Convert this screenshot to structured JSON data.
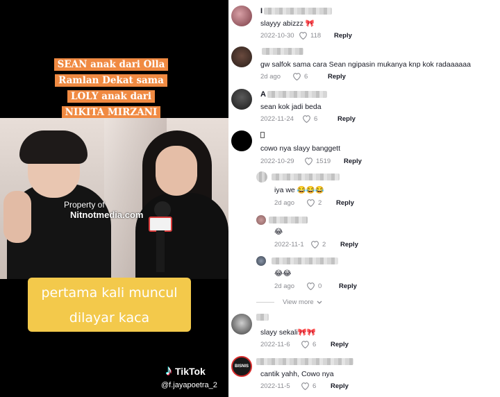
{
  "video": {
    "overlay_title_lines": [
      "SEAN anak dari Olla",
      "Ramlan Dekat sama",
      "LOLY anak dari",
      "NIKITA MIRZANI"
    ],
    "watermark": {
      "line1": "Property of",
      "line2": "Nitnotmedia.com"
    },
    "caption_lines": [
      "pertama kali muncul",
      "dilayar kaca"
    ],
    "platform": "TikTok",
    "handle": "@f.jayapoetra_2"
  },
  "comments": [
    {
      "username_prefix": "I",
      "text": "slayyy abizzz 🎀",
      "date": "2022-10-30",
      "likes": "118",
      "reply_label": "Reply"
    },
    {
      "username_prefix": "",
      "text": "gw salfok sama cara Sean ngipasin mukanya knp kok radaaaaaa",
      "date": "2d ago",
      "likes": "6",
      "reply_label": "Reply"
    },
    {
      "username_prefix": "A",
      "text": "sean kok jadi beda",
      "date": "2022-11-24",
      "likes": "6",
      "reply_label": "Reply"
    },
    {
      "username_prefix": "",
      "text": "cowo nya slayy banggett",
      "date": "2022-10-29",
      "likes": "1519",
      "reply_label": "Reply"
    },
    {
      "username_prefix": "",
      "text": "iya we 😂😂😂",
      "date": "2d ago",
      "likes": "2",
      "reply_label": "Reply"
    },
    {
      "username_prefix": "",
      "text": "😂",
      "date": "2022-11-1",
      "likes": "2",
      "reply_label": "Reply"
    },
    {
      "username_prefix": "",
      "text": "😂😂",
      "date": "2d ago",
      "likes": "0",
      "reply_label": "Reply"
    },
    {
      "username_prefix": "",
      "text": "slayy sekali🎀🎀",
      "date": "2022-11-6",
      "likes": "6",
      "reply_label": "Reply"
    },
    {
      "username_prefix": "",
      "text": "cantik yahh, Cowo nya",
      "date": "2022-11-5",
      "likes": "6",
      "reply_label": "Reply"
    }
  ],
  "view_more_label": "View more",
  "avatar_badge_text": "BISNIS",
  "colors": {
    "title_bg": "#f08a42",
    "caption_bg": "#f3c94b",
    "meta_gray": "#8a8b91"
  }
}
